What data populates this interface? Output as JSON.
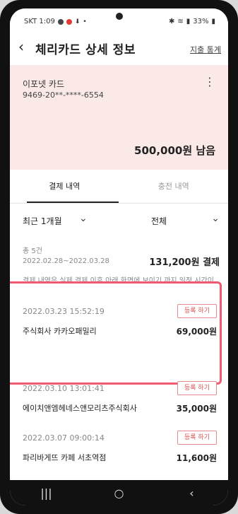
{
  "status": {
    "carrier_time": "SKT 1:09",
    "battery": "33%"
  },
  "header": {
    "back_label": "‹",
    "title": "체리카드 상세 정보",
    "stats_link": "지출 통계"
  },
  "card": {
    "name": "이포넷 카드",
    "number": "9469-20**-****-6554",
    "remaining": "500,000원 남음"
  },
  "tabs": [
    {
      "label": "결제 내역",
      "active": true
    },
    {
      "label": "충전 내역",
      "active": false
    }
  ],
  "filters": {
    "period": "최근 1개월",
    "type": "전체"
  },
  "summary": {
    "count": "총 5건",
    "range": "2022.02.28~2022.03.28",
    "total": "131,200원 결제"
  },
  "notice": "결제 내역은 실제 결제 이후 아래 화면에 보이기 까지 일정 시간이 소요될 수 있는 점 양해 부탁드립니다.",
  "register_label": "등록 하기",
  "transactions": [
    {
      "date": "2022.03.23 15:52:19",
      "merchant": "주식회사 카카오패밀리",
      "amount": "69,000원"
    },
    {
      "date": "2022.03.10 13:01:41",
      "merchant": "에이치앤엠헤네스앤모리츠주식회사",
      "amount": "35,000원"
    },
    {
      "date": "2022.03.07 09:00:14",
      "merchant": "파리바게뜨 카페 서초역점",
      "amount": "11,600원"
    }
  ],
  "navbar": {
    "recents_icon": "|||",
    "home_icon": "○",
    "back_icon": "‹"
  },
  "colors": {
    "card_bg": "#fbe9e7",
    "highlight": "#ef5a72",
    "register": "#d9534f"
  }
}
